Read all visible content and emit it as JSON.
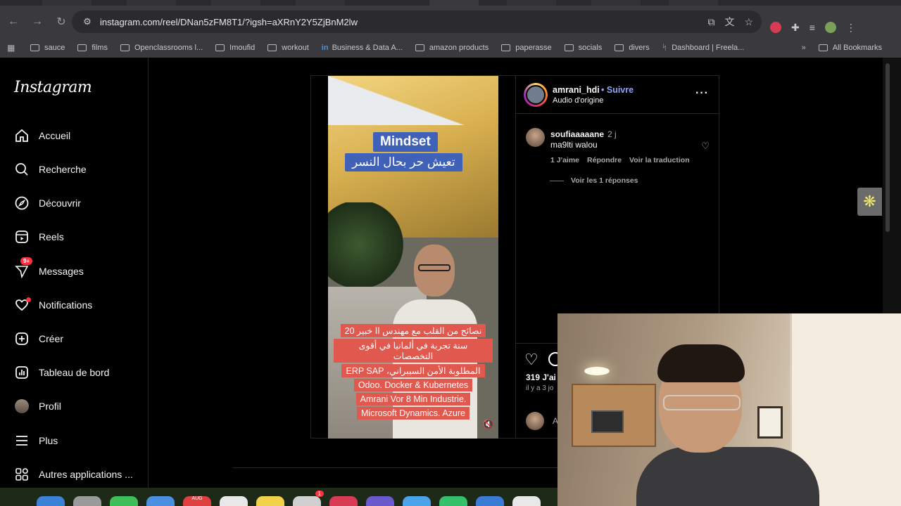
{
  "browser": {
    "url": "instagram.com/reel/DNan5zFM8T1/?igsh=aXRnY2Y5ZjBnM2lw",
    "bookmarks": [
      "sauce",
      "films",
      "Openclassrooms l...",
      "Imoufid",
      "workout",
      "Business & Data A...",
      "amazon products",
      "paperasse",
      "socials",
      "divers",
      "Dashboard | Freela..."
    ],
    "all_bookmarks": "All Bookmarks",
    "colors": {
      "toolbar": "#3a3a3e",
      "omnibox": "#2b2b2e"
    }
  },
  "instagram": {
    "logo": "Instagram",
    "nav": {
      "home": "Accueil",
      "search": "Recherche",
      "explore": "Découvrir",
      "reels": "Reels",
      "messages": "Messages",
      "messages_badge": "9+",
      "notifications": "Notifications",
      "create": "Créer",
      "dashboard": "Tableau de bord",
      "profile": "Profil",
      "more": "Plus",
      "other_apps": "Autres applications ..."
    },
    "post": {
      "username": "amrani_hdi",
      "follow": "Suivre",
      "audio": "Audio d'origine",
      "video_title": "Mindset",
      "video_subtitle": "تعيش حر بحال النسر",
      "caption_lines": [
        "نصائح من القلب مع مهندس اا خبير 20",
        "سنة تجربة في ألمانيا في أقوى التخصصات",
        "المطلوبة الأمن السيبراني، ERP SAP",
        "Odoo. Docker & Kubernetes",
        "Amrani Vor 8 Min Industrie.",
        "Microsoft Dynamics. Azure"
      ],
      "comment": {
        "user": "soufiaaaaane",
        "time": "2 j",
        "text": "ma9lti walou",
        "likes": "1 J'aime",
        "reply": "Répondre",
        "translate": "Voir la traduction",
        "view_replies": "Voir les 1 réponses"
      },
      "likes_count": "319 J'ai",
      "posted": "il y a 3 jo",
      "add_comment": "A"
    }
  },
  "dock": {
    "badge": "1",
    "calendar": "AUG"
  }
}
